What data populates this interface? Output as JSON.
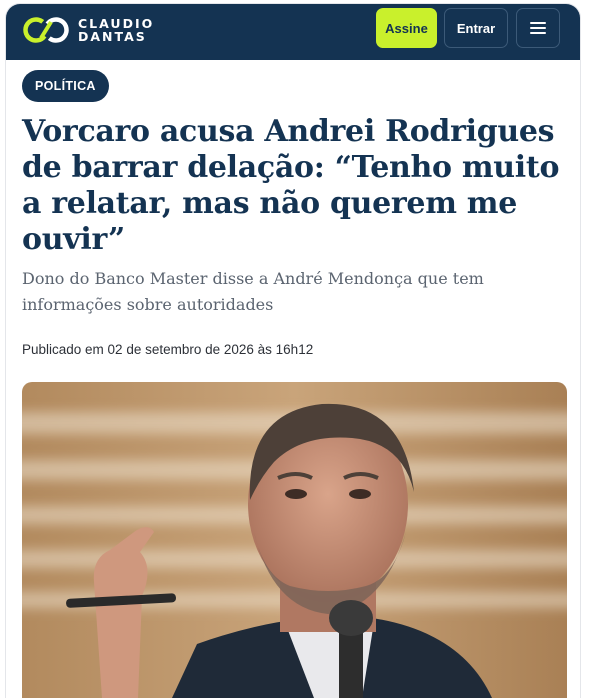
{
  "header": {
    "brand_line1": "CLAUDIO",
    "brand_line2": "DANTAS",
    "subscribe_label": "Assine",
    "login_label": "Entrar",
    "menu_icon": "hamburger-menu-icon"
  },
  "article": {
    "category": "POLÍTICA",
    "title": "Vorcaro acusa Andrei Rodrigues de barrar delação: “Tenho muito a relatar, mas não querem me ouvir”",
    "subtitle": "Dono do Banco Master disse a André Mendonça que tem informações sobre autoridades",
    "published": "Publicado em 02 de setembro de 2026 às 16h12"
  },
  "colors": {
    "navy": "#143352",
    "accent": "#c9f02c",
    "subtitle_gray": "#5b6470"
  }
}
